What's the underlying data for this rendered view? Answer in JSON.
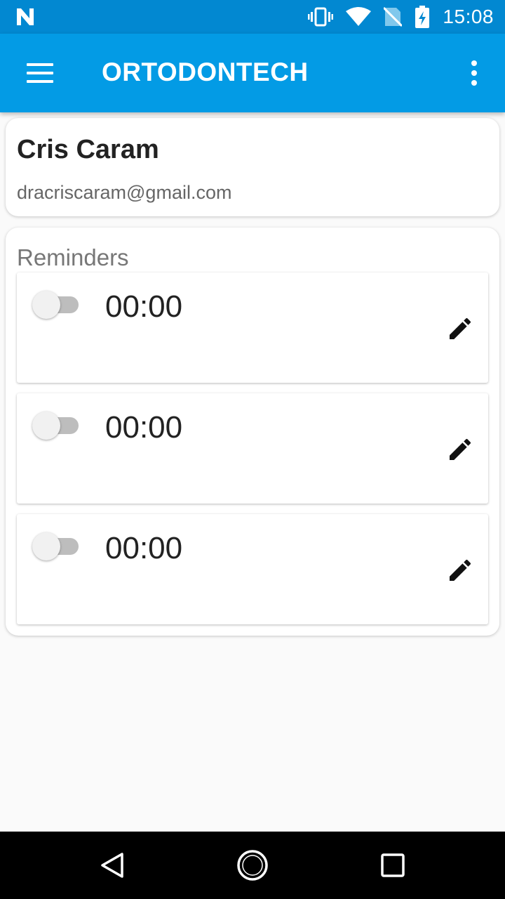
{
  "status_bar": {
    "time": "15:08",
    "icons": [
      "n-logo-icon",
      "vibrate-icon",
      "wifi-icon",
      "no-sim-icon",
      "battery-charging-icon"
    ]
  },
  "app_bar": {
    "title": "ORTODONTECH",
    "menu_icon": "hamburger-menu-icon",
    "overflow_icon": "more-vert-icon"
  },
  "profile": {
    "name": "Cris Caram",
    "email": "dracriscaram@gmail.com"
  },
  "reminders": {
    "section_title": "Reminders",
    "items": [
      {
        "enabled": false,
        "time": "00:00"
      },
      {
        "enabled": false,
        "time": "00:00"
      },
      {
        "enabled": false,
        "time": "00:00"
      }
    ]
  },
  "nav_bar": {
    "icons": [
      "back-icon",
      "home-icon",
      "recents-icon"
    ]
  },
  "colors": {
    "status_bar": "#0288d1",
    "app_bar": "#039be5",
    "background": "#fafafa"
  }
}
